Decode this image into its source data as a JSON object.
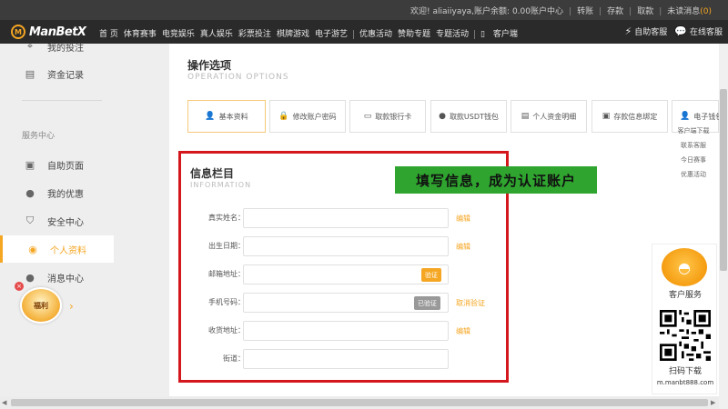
{
  "topbar": {
    "welcome": "欢迎! aliaiiyaya,账户余额: 0.00",
    "links": [
      "账户中心",
      "转账",
      "存款",
      "取款",
      "未读消息"
    ],
    "unread_count": "(0)"
  },
  "navbar": {
    "logo_text": "ManBetX",
    "items": [
      "首 页",
      "体育赛事",
      "电竞娱乐",
      "真人娱乐",
      "彩票投注",
      "棋牌游戏",
      "电子游艺"
    ],
    "items2": [
      "优惠活动",
      "赞助专题",
      "专题活动"
    ],
    "client": "客户端",
    "right": [
      "自助客服",
      "在线客服"
    ]
  },
  "sidebar": {
    "top_item": "我的投注",
    "items_top": [
      {
        "icon": "document-icon",
        "label": "资金记录"
      }
    ],
    "group_label": "服务中心",
    "items": [
      {
        "icon": "monitor-icon",
        "label": "自助页面"
      },
      {
        "icon": "gift-icon",
        "label": "我的优惠"
      },
      {
        "icon": "shield-icon",
        "label": "安全中心"
      },
      {
        "icon": "user-circle-icon",
        "label": "个人资料"
      },
      {
        "icon": "chat-icon",
        "label": "消息中心"
      }
    ]
  },
  "main": {
    "title": "操作选项",
    "subtitle": "OPERATION OPTIONS",
    "tabs": [
      {
        "icon": "user-icon",
        "label": "基本资料"
      },
      {
        "icon": "lock-icon",
        "label": "修改账户密码"
      },
      {
        "icon": "card-icon",
        "label": "取款银行卡"
      },
      {
        "icon": "tether-icon",
        "label": "取款USDT钱包"
      },
      {
        "icon": "clipboard-icon",
        "label": "个人资金明细"
      },
      {
        "icon": "wallet-icon",
        "label": "存款信息绑定"
      },
      {
        "icon": "user-icon",
        "label": "电子钱包"
      }
    ],
    "float_links": [
      "客户端下载",
      "联系客服",
      "今日赛事",
      "优惠活动"
    ]
  },
  "info": {
    "title": "信息栏目",
    "subtitle": "INFORMATION",
    "banner": "填写信息，成为认证账户",
    "rows": [
      {
        "label": "真实姓名：",
        "link": "编辑"
      },
      {
        "label": "出生日期：",
        "link": "编辑"
      },
      {
        "label": "邮箱地址：",
        "button": "验证"
      },
      {
        "label": "手机号码：",
        "button": "已验证",
        "link": "取消验证"
      },
      {
        "label": "收货地址：",
        "link": "编辑"
      },
      {
        "label": "街道：",
        "link": ""
      }
    ]
  },
  "cs_widget": {
    "title": "客户服务",
    "download": "扫码下载",
    "url": "m.manbt888.com"
  },
  "promo": {
    "label": "福利"
  },
  "colors": {
    "accent": "#f5a623",
    "highlight_border": "#d4171d",
    "banner_bg": "#2fa52f",
    "nav_bg": "#2a2a2a"
  }
}
